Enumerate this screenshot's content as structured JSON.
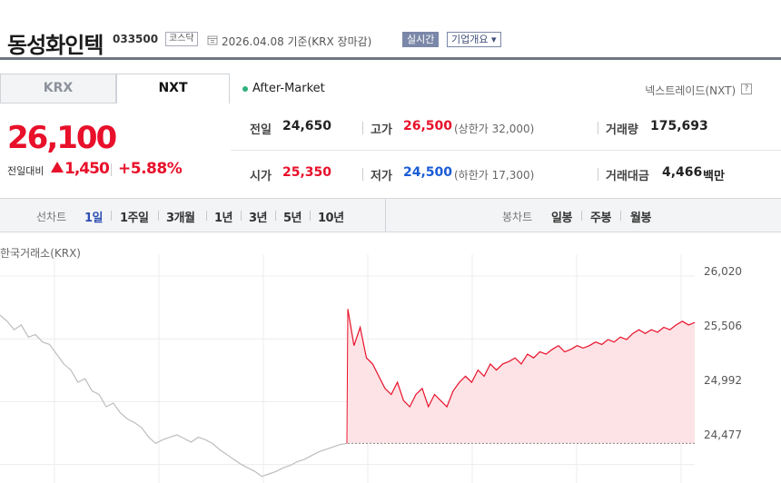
{
  "header": {
    "stock_name": "동성화인텍",
    "stock_code": "033500",
    "market_badge": "코스닥",
    "base_date": "2026.04.08  기준(KRX 장마감)",
    "realtime_button": "실시간",
    "company_button": "기업개요 ▾"
  },
  "tabs": [
    {
      "label": "KRX",
      "active": false
    },
    {
      "label": "NXT",
      "active": true
    }
  ],
  "session": {
    "after_market_label": "After-Market",
    "exchange_label": "넥스트레이드(NXT)",
    "help_icon": "?"
  },
  "price": {
    "current": "26,100",
    "change_label": "전일대비",
    "change_value": "1,450",
    "change_pct": "+5.88%",
    "direction": "up"
  },
  "info": {
    "prev_close": {
      "label": "전일",
      "value": "24,650"
    },
    "high": {
      "label": "고가",
      "value": "26,500",
      "sub": "(상한가 32,000)"
    },
    "volume": {
      "label": "거래량",
      "value": "175,693"
    },
    "open": {
      "label": "시가",
      "value": "25,350"
    },
    "low": {
      "label": "저가",
      "value": "24,500",
      "sub": "(하한가 17,300)"
    },
    "amount": {
      "label": "거래대금",
      "value": "4,466",
      "unit": "백만"
    }
  },
  "toolbar": {
    "line_chart_label": "선차트",
    "line_periods": [
      "1일",
      "1주일",
      "3개월",
      "1년",
      "3년",
      "5년",
      "10년"
    ],
    "active_period": "1일",
    "candle_chart_label": "봉차트",
    "candle_periods": [
      "일봉",
      "주봉",
      "월봉"
    ]
  },
  "chart_data": {
    "type": "line",
    "source_label": "한국거래소(KRX)",
    "y_ticks": [
      "26,020",
      "25,506",
      "24,992",
      "24,477"
    ],
    "ylim": [
      24400,
      26050
    ],
    "reference_line": 24650,
    "colors": {
      "krx_series": "#bdbdbd",
      "nxt_series": "#e8102a",
      "nxt_fill": "#fde3e5"
    },
    "series": [
      {
        "values": [
          25700,
          25650,
          25580,
          25620,
          25520,
          25540,
          25480,
          25460,
          25380,
          25300,
          25250,
          25150,
          25180,
          25080,
          25050,
          24950,
          24980,
          24900,
          24850,
          24820,
          24780,
          24700,
          24650,
          24680,
          24700,
          24720,
          24690,
          24660,
          24700,
          24680,
          24650,
          24600,
          24560,
          24520,
          24480,
          24450,
          24420,
          24380,
          24400,
          24420,
          24450,
          24470,
          24500,
          24520,
          24550,
          24580,
          24600,
          24620,
          24640,
          24650
        ]
      },
      {
        "values": [
          25750,
          25450,
          25600,
          25350,
          25300,
          25200,
          25100,
          25050,
          25150,
          25000,
          24950,
          25050,
          25100,
          24950,
          25050,
          25000,
          24950,
          25080,
          25150,
          25200,
          25150,
          25250,
          25200,
          25300,
          25250,
          25300,
          25320,
          25350,
          25300,
          25380,
          25350,
          25400,
          25380,
          25420,
          25450,
          25400,
          25420,
          25450,
          25430,
          25450,
          25480,
          25460,
          25500,
          25480,
          25520,
          25500,
          25550,
          25580,
          25550,
          25580,
          25560,
          25600,
          25580,
          25620,
          25650,
          25620,
          25640
        ]
      }
    ]
  }
}
